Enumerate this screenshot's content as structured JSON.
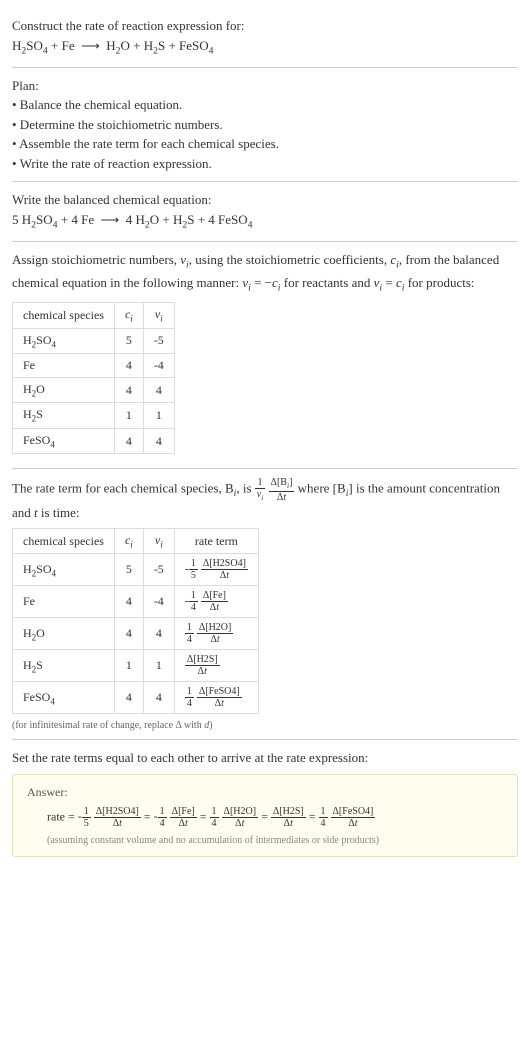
{
  "intro": {
    "prompt": "Construct the rate of reaction expression for:",
    "equation": "H₂SO₄ + Fe ⟶ H₂O + H₂S + FeSO₄"
  },
  "plan": {
    "heading": "Plan:",
    "items": [
      "• Balance the chemical equation.",
      "• Determine the stoichiometric numbers.",
      "• Assemble the rate term for each chemical species.",
      "• Write the rate of reaction expression."
    ]
  },
  "balanced": {
    "heading": "Write the balanced chemical equation:",
    "equation": "5 H₂SO₄ + 4 Fe ⟶ 4 H₂O + H₂S + 4 FeSO₄"
  },
  "stoich": {
    "intro_a": "Assign stoichiometric numbers, ",
    "intro_b": ", using the stoichiometric coefficients, ",
    "intro_c": ", from the balanced chemical equation in the following manner: ",
    "intro_d": " for reactants and ",
    "intro_e": " for products:",
    "headers": [
      "chemical species",
      "cᵢ",
      "νᵢ"
    ],
    "rows": [
      {
        "species": "H₂SO₄",
        "c": "5",
        "v": "-5"
      },
      {
        "species": "Fe",
        "c": "4",
        "v": "-4"
      },
      {
        "species": "H₂O",
        "c": "4",
        "v": "4"
      },
      {
        "species": "H₂S",
        "c": "1",
        "v": "1"
      },
      {
        "species": "FeSO₄",
        "c": "4",
        "v": "4"
      }
    ]
  },
  "rateterm": {
    "intro_a": "The rate term for each chemical species, B",
    "intro_b": ", is ",
    "intro_c": " where [B",
    "intro_d": "] is the amount concentration and ",
    "intro_e": " is time:",
    "headers": [
      "chemical species",
      "cᵢ",
      "νᵢ",
      "rate term"
    ],
    "rows": [
      {
        "species": "H₂SO₄",
        "c": "5",
        "v": "-5",
        "coef_num": "1",
        "coef_den": "5",
        "sign": "-",
        "delta": "Δ[H2SO4]"
      },
      {
        "species": "Fe",
        "c": "4",
        "v": "-4",
        "coef_num": "1",
        "coef_den": "4",
        "sign": "-",
        "delta": "Δ[Fe]"
      },
      {
        "species": "H₂O",
        "c": "4",
        "v": "4",
        "coef_num": "1",
        "coef_den": "4",
        "sign": "",
        "delta": "Δ[H2O]"
      },
      {
        "species": "H₂S",
        "c": "1",
        "v": "1",
        "coef_num": "",
        "coef_den": "",
        "sign": "",
        "delta": "Δ[H2S]"
      },
      {
        "species": "FeSO₄",
        "c": "4",
        "v": "4",
        "coef_num": "1",
        "coef_den": "4",
        "sign": "",
        "delta": "Δ[FeSO4]"
      }
    ],
    "note": "(for infinitesimal rate of change, replace Δ with d)"
  },
  "final": {
    "intro": "Set the rate terms equal to each other to arrive at the rate expression:",
    "answer_label": "Answer:",
    "rate_prefix": "rate = ",
    "terms": [
      {
        "sign": "-",
        "num": "1",
        "den": "5",
        "delta": "Δ[H2SO4]"
      },
      {
        "sign": "-",
        "num": "1",
        "den": "4",
        "delta": "Δ[Fe]"
      },
      {
        "sign": "",
        "num": "1",
        "den": "4",
        "delta": "Δ[H2O]"
      },
      {
        "sign": "",
        "num": "",
        "den": "",
        "delta": "Δ[H2S]"
      },
      {
        "sign": "",
        "num": "1",
        "den": "4",
        "delta": "Δ[FeSO4]"
      }
    ],
    "note": "(assuming constant volume and no accumulation of intermediates or side products)"
  },
  "chart_data": {
    "type": "table",
    "tables": [
      {
        "title": "Stoichiometric numbers",
        "columns": [
          "chemical species",
          "c_i",
          "ν_i"
        ],
        "rows": [
          [
            "H2SO4",
            5,
            -5
          ],
          [
            "Fe",
            4,
            -4
          ],
          [
            "H2O",
            4,
            4
          ],
          [
            "H2S",
            1,
            1
          ],
          [
            "FeSO4",
            4,
            4
          ]
        ]
      },
      {
        "title": "Rate terms",
        "columns": [
          "chemical species",
          "c_i",
          "ν_i",
          "rate term"
        ],
        "rows": [
          [
            "H2SO4",
            5,
            -5,
            "-(1/5) Δ[H2SO4]/Δt"
          ],
          [
            "Fe",
            4,
            -4,
            "-(1/4) Δ[Fe]/Δt"
          ],
          [
            "H2O",
            4,
            4,
            "(1/4) Δ[H2O]/Δt"
          ],
          [
            "H2S",
            1,
            1,
            "Δ[H2S]/Δt"
          ],
          [
            "FeSO4",
            4,
            4,
            "(1/4) Δ[FeSO4]/Δt"
          ]
        ]
      }
    ]
  }
}
